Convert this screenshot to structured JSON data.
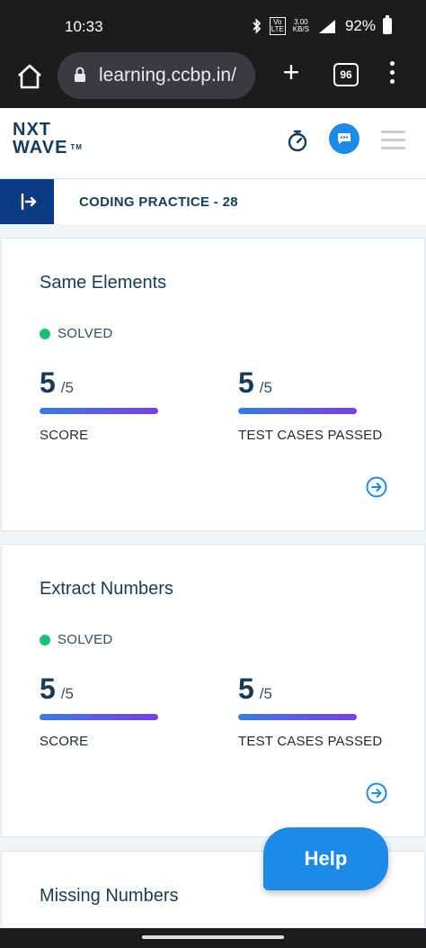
{
  "status_bar": {
    "time": "10:33",
    "network_speed_value": "3.00",
    "network_speed_unit": "KB/S",
    "volte": "Vo LTE",
    "signal": "4G",
    "battery": "92%"
  },
  "browser": {
    "url": "learning.ccbp.in/",
    "tab_count": "96"
  },
  "logo": {
    "line1": "NXT",
    "line2": "WAVE",
    "tm": "TM"
  },
  "practice": {
    "title": "CODING PRACTICE - 28"
  },
  "cards": [
    {
      "title": "Same Elements",
      "status": "SOLVED",
      "score": "5",
      "score_total": "/5",
      "score_label": "SCORE",
      "tests": "5",
      "tests_total": "/5",
      "tests_label": "TEST CASES PASSED"
    },
    {
      "title": "Extract Numbers",
      "status": "SOLVED",
      "score": "5",
      "score_total": "/5",
      "score_label": "SCORE",
      "tests": "5",
      "tests_total": "/5",
      "tests_label": "TEST CASES PASSED"
    },
    {
      "title": "Missing Numbers"
    }
  ],
  "help_button": "Help",
  "colors": {
    "primary": "#183b56",
    "accent": "#1e8ae8",
    "solved": "#1fbf75",
    "bar_start": "#3b7ddd",
    "bar_end": "#7b3fe0"
  }
}
